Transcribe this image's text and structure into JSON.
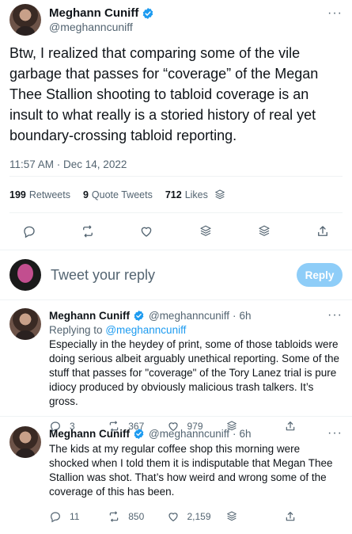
{
  "main_tweet": {
    "author_name": "Meghann Cuniff",
    "handle": "@meghanncuniff",
    "text": "Btw, I realized that comparing some of the vile garbage that passes for “coverage” of the Megan Thee Stallion shooting to tabloid coverage is an insult to what really is a storied history of real yet boundary-crossing tabloid reporting.",
    "timestamp": "11:57 AM · Dec 14, 2022",
    "more": "···",
    "retweets_count": "199",
    "retweets_label": "Retweets",
    "quotes_count": "9",
    "quotes_label": "Quote Tweets",
    "likes_count": "712",
    "likes_label": "Likes"
  },
  "reply_compose": {
    "placeholder": "Tweet your reply",
    "button_label": "Reply"
  },
  "replies": [
    {
      "author_name": "Meghann Cuniff",
      "handle": "@meghanncuniff",
      "time": "6h",
      "replying_prefix": "Replying to",
      "replying_to": "@meghanncuniff",
      "text": "Especially in the heydey of print, some of those tabloids were doing serious albeit arguably unethical reporting. Some of the stuff that passes for \"coverage\" of the Tory Lanez trial is pure idiocy produced by obviously malicious trash talkers. It’s gross.",
      "replies": "3",
      "retweets": "367",
      "likes": "979"
    },
    {
      "author_name": "Meghann Cuniff",
      "handle": "@meghanncuniff",
      "time": "6h",
      "text": "The kids at my regular coffee shop this morning were shocked when I told them it is indisputable that Megan Thee Stallion was shot. That’s how weird and wrong some of the coverage of this has been.",
      "replies": "11",
      "retweets": "850",
      "likes": "2,159"
    }
  ],
  "colors": {
    "verified": "#1d9bf0",
    "link": "#1d9bf0",
    "secondary_text": "#536471",
    "reply_button": "#8ecdf8"
  }
}
